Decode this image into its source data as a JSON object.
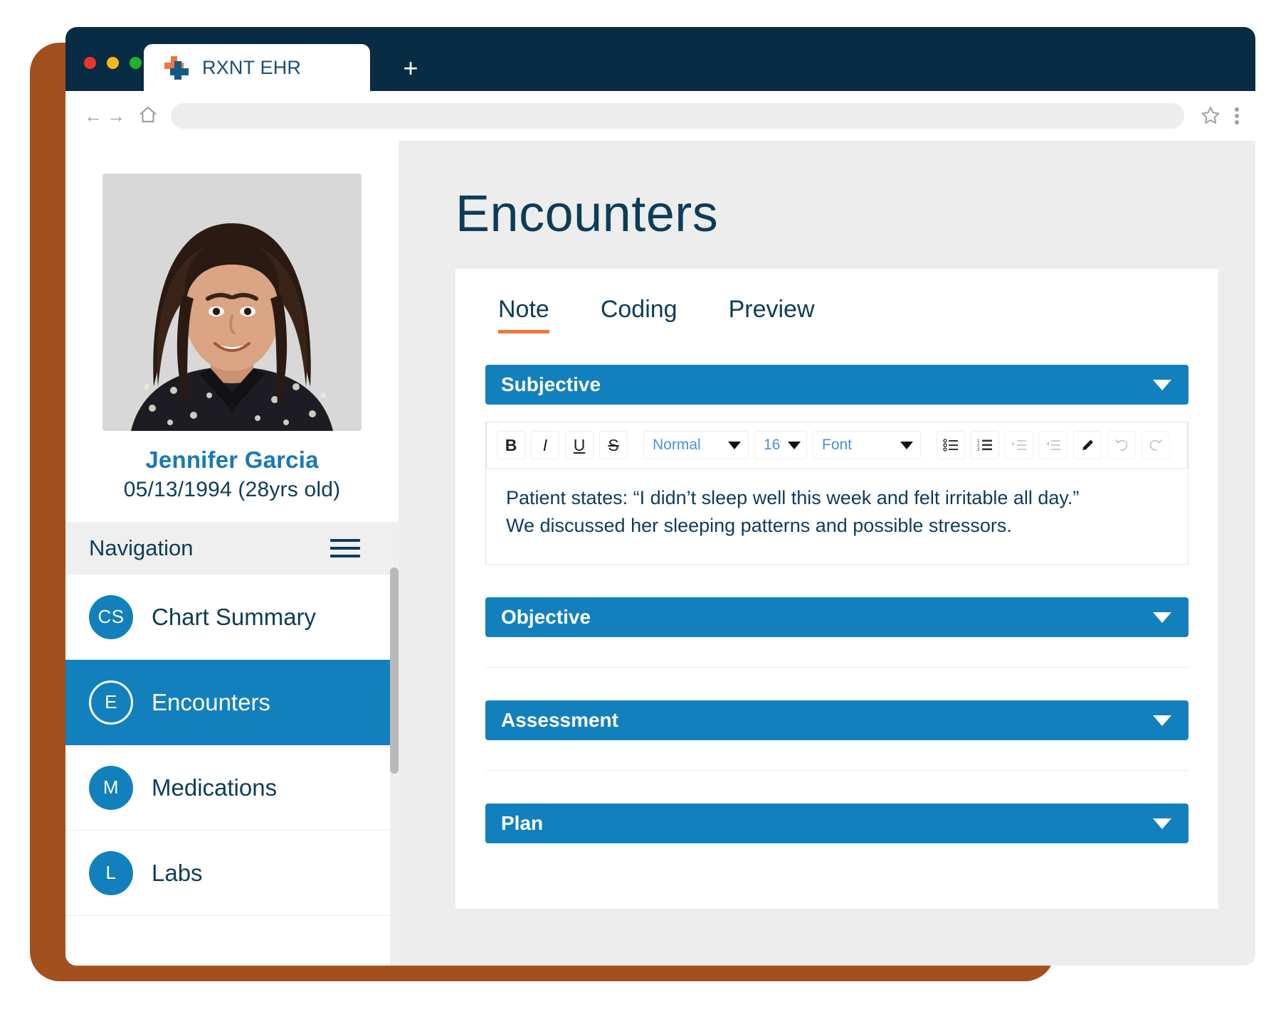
{
  "browser": {
    "tab_title": "RXNT EHR",
    "new_tab_label": "+",
    "url_value": "",
    "url_placeholder": "",
    "back_icon": "←",
    "forward_icon": "→",
    "traffic_lights": [
      "#f0342a",
      "#f8b812",
      "#22b22a"
    ],
    "titlebar_color": "#072c44"
  },
  "patient": {
    "name": "Jennifer Garcia",
    "dob_age": "05/13/1994 (28yrs old)",
    "name_color": "#1a78b8",
    "dob_color": "#0e3c58"
  },
  "sidebar": {
    "header_label": "Navigation",
    "accent": "#1280bd",
    "items": [
      {
        "initials": "CS",
        "label": "Chart Summary",
        "active": false
      },
      {
        "initials": "E",
        "label": "Encounters",
        "active": true
      },
      {
        "initials": "M",
        "label": "Medications",
        "active": false
      },
      {
        "initials": "L",
        "label": "Labs",
        "active": false
      }
    ]
  },
  "main": {
    "page_title": "Encounters",
    "tabs": [
      {
        "label": "Note",
        "active": true
      },
      {
        "label": "Coding",
        "active": false
      },
      {
        "label": "Preview",
        "active": false
      }
    ],
    "active_tab_underline_color": "#f2763c",
    "sections": [
      {
        "label": "Subjective",
        "expanded": true
      },
      {
        "label": "Objective",
        "expanded": false
      },
      {
        "label": "Assessment",
        "expanded": false
      },
      {
        "label": "Plan",
        "expanded": false
      }
    ],
    "editor": {
      "toolbar": {
        "bold": "B",
        "italic": "I",
        "underline": "U",
        "strikethrough": "S",
        "style_select": "Normal",
        "size_select": "16",
        "font_select": "Font",
        "bullet_list_icon": "bullet-list-icon",
        "numbered_list_icon": "numbered-list-icon",
        "indent_icon": "indent-icon",
        "outdent_icon": "outdent-icon",
        "pen_icon": "pen-icon",
        "undo_icon": "undo-icon",
        "redo_icon": "redo-icon"
      },
      "note_line_1": "Patient states: “I didn’t sleep well this week and felt irritable all day.”",
      "note_line_2": "We discussed her sleeping patterns and possible stressors."
    }
  },
  "theme": {
    "frame_brown": "#a2501e",
    "dark_navy": "#072c44",
    "brand_blue": "#1280bd",
    "text_navy": "#0e3c58",
    "page_bg": "#ededed",
    "orange": "#f2763c"
  }
}
